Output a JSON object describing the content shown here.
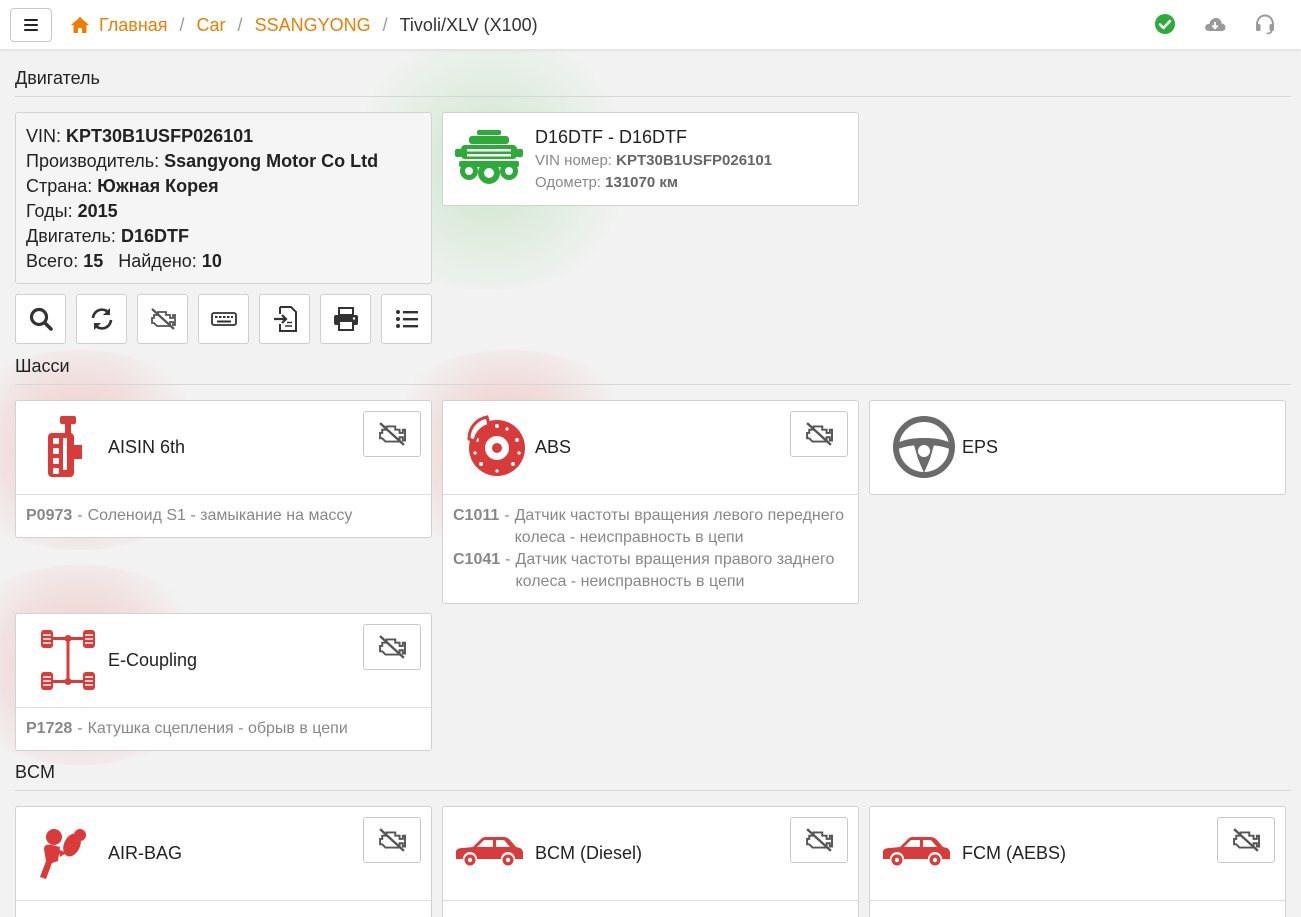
{
  "header": {
    "breadcrumb": {
      "home": "Главная",
      "items": [
        "Car",
        "SSANGYONG"
      ],
      "current": "Tivoli/XLV (X100)"
    },
    "status_icon": "check-circle-icon",
    "cloud_icon": "cloud-download-icon",
    "support_icon": "headset-icon",
    "colors": {
      "accent": "#f07d00",
      "ok": "#2eaa3a",
      "fault": "#d93a3a"
    }
  },
  "sections": {
    "engine": "Двигатель",
    "chassis": "Шасси",
    "bcm": "BCM"
  },
  "vehicle_info": {
    "vin_label": "VIN:",
    "vin": "KPT30B1USFP026101",
    "maker_label": "Производитель:",
    "maker": "Ssangyong Motor Co Ltd",
    "country_label": "Страна:",
    "country": "Южная Корея",
    "years_label": "Годы:",
    "years": "2015",
    "engine_label": "Двигатель:",
    "engine": "D16DTF",
    "total_label": "Всего:",
    "total": "15",
    "found_label": "Найдено:",
    "found": "10"
  },
  "engine_card": {
    "title": "D16DTF - D16DTF",
    "vin_label": "VIN номер:",
    "vin": "KPT30B1USFP026101",
    "odometer_label": "Одометр:",
    "odometer": "131070 км"
  },
  "tools": [
    "search-icon",
    "refresh-icon",
    "clear-dtc-icon",
    "keyboard-icon",
    "import-icon",
    "print-icon",
    "list-icon"
  ],
  "modules": {
    "aisin": {
      "name": "AISIN 6th",
      "dtcs": [
        {
          "code": "P0973",
          "desc": "Соленоид S1 - замыкание на массу"
        }
      ]
    },
    "abs": {
      "name": "ABS",
      "dtcs": [
        {
          "code": "C1011",
          "desc": "Датчик частоты вращения левого переднего колеса - неисправность в цепи"
        },
        {
          "code": "C1041",
          "desc": "Датчик частоты вращения правого заднего колеса - неисправность в цепи"
        }
      ]
    },
    "eps": {
      "name": "EPS"
    },
    "ecoupling": {
      "name": "E-Coupling",
      "dtcs": [
        {
          "code": "P1728",
          "desc": "Катушка сцепления - обрыв в цепи"
        }
      ]
    },
    "airbag": {
      "name": "AIR-BAG"
    },
    "bcm_diesel": {
      "name": "BCM (Diesel)"
    },
    "fcm": {
      "name": "FCM (AEBS)"
    }
  }
}
